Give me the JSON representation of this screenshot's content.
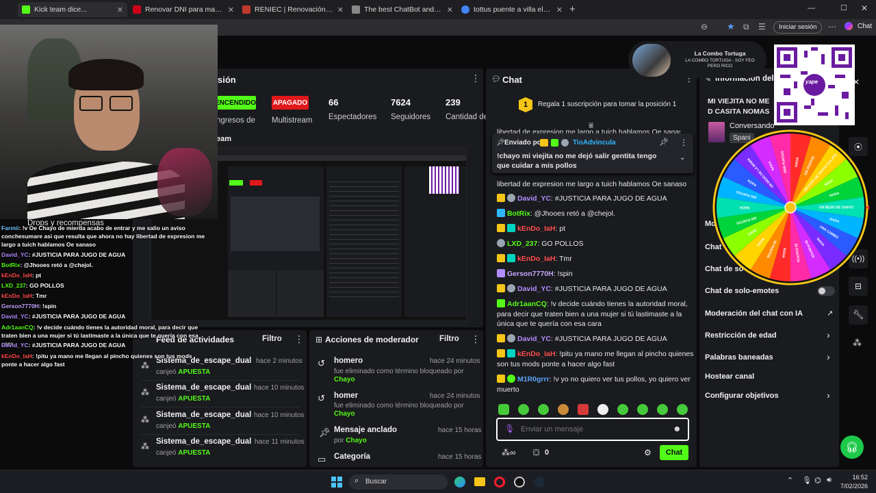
{
  "browser": {
    "tabs": [
      {
        "title": "Kick team dice...",
        "color": "#53fc18"
      },
      {
        "title": "Renovar DNI para mayores de 17 años",
        "color": "#d0021b"
      },
      {
        "title": "RENIEC | Renovación por caducidad",
        "color": "#c0392b"
      },
      {
        "title": "The best ChatBot and Widgets for",
        "color": "#888888"
      },
      {
        "title": "tottus puente a villa el salvador cu",
        "color": "#4285f4"
      }
    ],
    "signin_label": "Iniciar sesión",
    "chat_label": "Chat"
  },
  "profile_card": {
    "name": "La Combo Tortuga",
    "line1": "LA COMBO TORTUGA - SOY FEO",
    "line2": "PERO RICO"
  },
  "qr": {
    "brand": "yape"
  },
  "stream_panel": {
    "title": "sión",
    "on_label": "ENCENDIDO",
    "off_label": "APAGADO",
    "ingresos": "ngresos de",
    "multistream": "Multistream",
    "stats": [
      {
        "value": "66",
        "label": "Espectadores"
      },
      {
        "value": "7624",
        "label": "Seguidores"
      },
      {
        "value": "239",
        "label": "Cantidad de"
      }
    ],
    "preview_title": "eam"
  },
  "drops": "Drops y recompensas",
  "activity": {
    "title": "Feed de actividades",
    "filter": "Filtro",
    "items": [
      {
        "name": "Sistema_de_escape_dual",
        "action": "canjeó",
        "reward": "APUESTA",
        "time": "hace 2 minutos"
      },
      {
        "name": "Sistema_de_escape_dual",
        "action": "canjeó",
        "reward": "APUESTA",
        "time": "hace 10 minutos"
      },
      {
        "name": "Sistema_de_escape_dual",
        "action": "canjeó",
        "reward": "APUESTA",
        "time": "hace 10 minutos"
      },
      {
        "name": "Sistema_de_escape_dual",
        "action": "canjeó",
        "reward": "APUESTA",
        "time": "hace 11 minutos"
      }
    ]
  },
  "mod_actions": {
    "title": "Acciones de moderador",
    "filter": "Filtro",
    "items": [
      {
        "term": "homero",
        "desc": "fue eliminado como término bloqueado por",
        "by": "Chayo",
        "time": "hace 24 minutos"
      },
      {
        "term": "homer",
        "desc": "fue eliminado como término bloqueado por",
        "by": "Chayo",
        "time": "hace 24 minutos"
      },
      {
        "term": "Mensaje anclado",
        "desc": "por",
        "by": "Chayo",
        "time": "hace 15 horas"
      },
      {
        "term": "Categoría",
        "desc": "",
        "by": "",
        "time": "hace 15 horas"
      }
    ]
  },
  "chat": {
    "title": "Chat",
    "gift_banner": "Regala 1 suscripción para tomar la posición 1",
    "gift_rank": "1",
    "pinned_by_label": "Enviado por",
    "pinned_user": "TioAdvincula",
    "pinned_text": "!chayo mi viejita no me dejó salir gentita tengo que cuidar a mis pollos",
    "partial_top": "libertad de expresion me largo a tuich hablamos Oe sanaso",
    "messages": [
      {
        "user": "David_YC",
        "color": "#b28cff",
        "text": ": #JUSTICIA PARA JUGO DE AGUA"
      },
      {
        "user": "BotRix",
        "color": "#53fc18",
        "text": ": @Jhooes retó a @chejol."
      },
      {
        "user": "kEnDo_IaH",
        "color": "#ff4d4d",
        "text": ": pt"
      },
      {
        "user": "LXD_237",
        "color": "#53fc18",
        "text": ": GO POLLOS"
      },
      {
        "user": "kEnDo_IaH",
        "color": "#ff4d4d",
        "text": ": Tmr"
      },
      {
        "user": "Gerson7770H",
        "color": "#c7a6ff",
        "text": ": !spin"
      },
      {
        "user": "David_YC",
        "color": "#b28cff",
        "text": ": #JUSTICIA PARA JUGO DE AGUA"
      },
      {
        "user": "Adr1aanCQ",
        "color": "#53fc18",
        "text": ": !v decide cuándo tienes la autoridad moral, para decir que traten bien a una mujer si tú lastimaste a la única que te quería con esa cara"
      },
      {
        "user": "David_YC",
        "color": "#b28cff",
        "text": ": #JUSTICIA PARA JUGO DE AGUA"
      },
      {
        "user": "kEnDo_IaH",
        "color": "#ff4d4d",
        "text": ": !pitu ya mano me llegan al pincho quienes son tus mods ponte a hacer algo fast"
      },
      {
        "user": "M1R0grrr",
        "color": "#58a6ff",
        "text": ": !v yo no quiero ver tus pollos, yo quiero ver muerto"
      }
    ],
    "input_placeholder": "Enviar un mensaje",
    "points": "0",
    "send_label": "Chat"
  },
  "info_panel": {
    "title": "Información del s",
    "stream_title": "MI VIEJITA NO ME D CASITA NOMAS",
    "category": "Conversando",
    "lang": "Spani",
    "settings": [
      "Mo",
      "Chat",
      "Chat de so",
      "Chat de solo-emotes",
      "Moderación del chat con IA",
      "Restricción de edad",
      "Palabras baneadas",
      "Hostear canal",
      "Configurar objetivos"
    ]
  },
  "wheel": {
    "segments": [
      "NADA",
      "100 PUNTOS",
      "UN FOTO DE CHAYO CALATO",
      "NADA",
      "NADA",
      "UN BESO DE CHAYO",
      "NADA",
      "UNA COMBO",
      "NADA",
      "50 PUNTOS",
      "20 PUNTOS",
      "NADA",
      "50 PUNTOS",
      "NADA",
      "NADA",
      "300 PUNTOS",
      "NADA",
      "200 PUNTOS",
      "NADA",
      "UN BESO DE LA MAMA",
      "NADA",
      "1000 PUNTOS"
    ],
    "colors": [
      "#ff2b2b",
      "#ff8a00",
      "#ffd400",
      "#8cff00",
      "#00d43a",
      "#00e0b0",
      "#00b4ff",
      "#2a5bff",
      "#7a2bff",
      "#d42bff",
      "#ff2ba8"
    ]
  },
  "overlay_chat": [
    {
      "user": "Farmii",
      "text": ": !v Oe Chayo de mierda acabo de entrar y me salio un aviso conchesumare asi que resulta que ahora no hay libertad de expresion me largo a tuich hablamos Oe sanaso",
      "color": "#6ec6ff"
    },
    {
      "user": "David_YC",
      "text": ": #JUSTICIA PARA JUGO DE AGUA",
      "color": "#b28cff"
    },
    {
      "user": "BotRix",
      "text": ": @Jhooes retó a @chejol.",
      "color": "#53fc18"
    },
    {
      "user": "kEnDo_IaH",
      "text": ": pt",
      "color": "#ff4d4d"
    },
    {
      "user": "LXD_237",
      "text": ": GO POLLOS",
      "color": "#53fc18"
    },
    {
      "user": "kEnDo_IaH",
      "text": ": Tmr",
      "color": "#ff4d4d"
    },
    {
      "user": "Gerson7770H",
      "text": ": !spin",
      "color": "#c7a6ff"
    },
    {
      "user": "David_YC",
      "text": ": #JUSTICIA PARA JUGO DE AGUA",
      "color": "#b28cff"
    },
    {
      "user": "Adr1aanCQ",
      "text": ": !v decide cuándo tienes la autoridad moral, para decir que traten bien a una mujer si tú lastimaste a la única que te quería con esa cara",
      "color": "#53fc18"
    },
    {
      "user": "David_YC",
      "text": ": #JUSTICIA PARA JUGO DE AGUA",
      "color": "#b28cff"
    },
    {
      "user": "kEnDo_IaH",
      "text": ": !pitu ya mano me llegan al pincho quienes son tus mods ponte a hacer algo fast",
      "color": "#ff4d4d"
    }
  ],
  "taskbar": {
    "search": "Buscar",
    "time": "16:52",
    "date": "7/02/2026"
  }
}
